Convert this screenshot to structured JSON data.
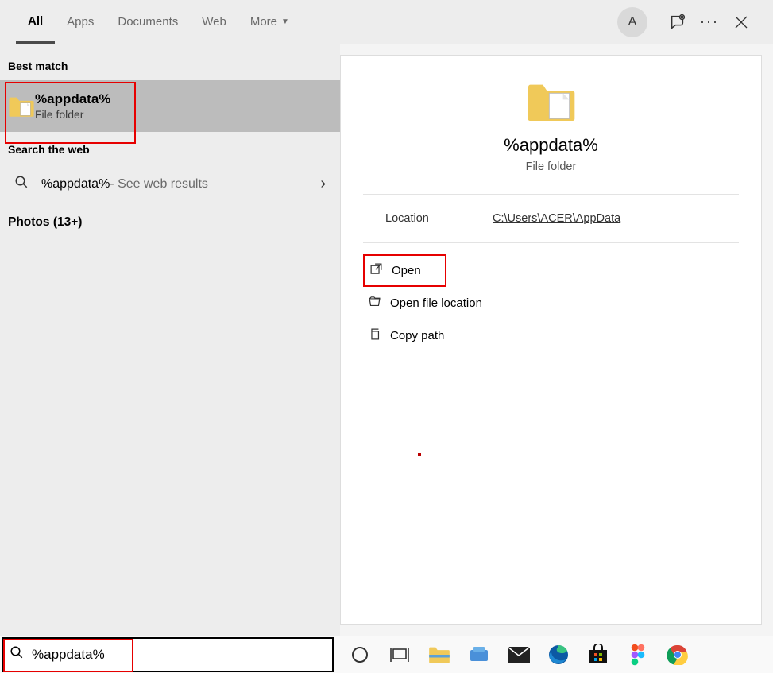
{
  "tabs": {
    "all": "All",
    "apps": "Apps",
    "documents": "Documents",
    "web": "Web",
    "more": "More"
  },
  "avatar_letter": "A",
  "sections": {
    "best_match": "Best match",
    "search_web": "Search the web",
    "photos": "Photos (13+)"
  },
  "best_match": {
    "title": "%appdata%",
    "sub": "File folder"
  },
  "web": {
    "query": "%appdata%",
    "suffix": " - See web results"
  },
  "preview": {
    "title": "%appdata%",
    "sub": "File folder",
    "location_label": "Location",
    "location_value": "C:\\Users\\ACER\\AppData"
  },
  "actions": {
    "open": "Open",
    "open_location": "Open file location",
    "copy_path": "Copy path"
  },
  "search_input": "%appdata%"
}
